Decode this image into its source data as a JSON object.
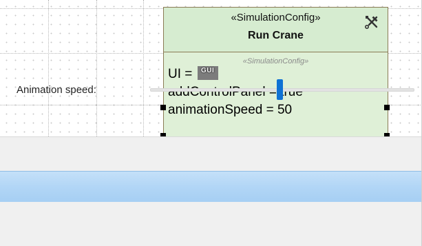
{
  "diagram": {
    "element": {
      "stereotype": "«SimulationConfig»",
      "name": "Run Crane",
      "tagline": "«SimulationConfig»",
      "properties": {
        "ui_label": "UI = ",
        "ui_icon_text": "GUI",
        "add_control_panel": "addControlPanel = true",
        "animation_speed": "animationSpeed = 50"
      },
      "icon": "tools-icon",
      "fill_color": "#dff0d7",
      "border_color": "#8a7a54"
    }
  },
  "panel": {
    "animation_speed_label": "Animation speed:",
    "slider": {
      "value_fraction": 0.49,
      "accent_color": "#0f72d4"
    },
    "titlebar_color": "#b2d6f6"
  }
}
